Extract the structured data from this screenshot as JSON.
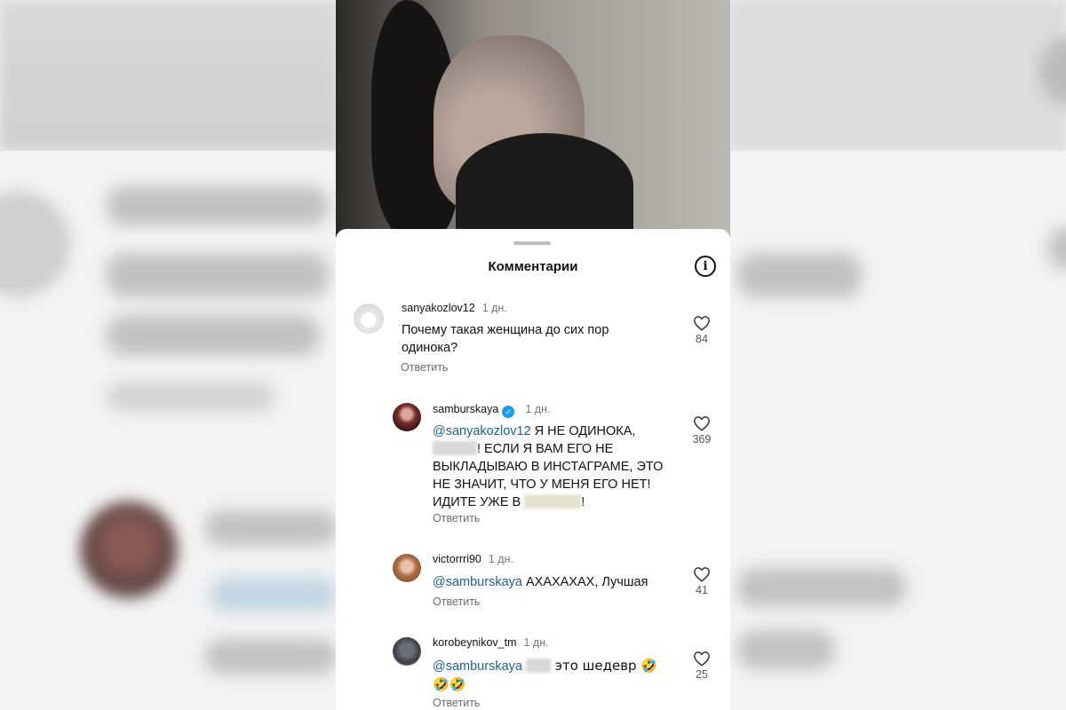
{
  "sheet": {
    "title": "Комментарии"
  },
  "icons": {
    "info": "info-icon",
    "like": "heart-icon",
    "verified": "verified-badge-icon"
  },
  "colors": {
    "mention": "#1e5f8c",
    "verified": "#1d9bf0"
  },
  "comments": [
    {
      "username": "sanyakozlov12",
      "time": "1 дн.",
      "text": "Почему такая женщина до сих пор одинока?",
      "reply_label": "Ответить",
      "likes": "84"
    },
    {
      "username": "samburskaya",
      "verified": true,
      "time": "1 дн.",
      "mention": "@sanyakozlov12",
      "text_a": " Я НЕ ОДИНОКА,",
      "text_b": "! ЕСЛИ Я ВАМ ЕГО НЕ ВЫКЛАДЫВАЮ В ИНСТАГРАМЕ, ЭТО НЕ ЗНАЧИТ, ЧТО У МЕНЯ ЕГО НЕТ! ИДИТЕ УЖЕ В",
      "text_c": "!",
      "reply_label": "Ответить",
      "likes": "369"
    },
    {
      "username": "victorrri90",
      "time": "1 дн.",
      "mention": "@samburskaya",
      "text": " АХАХАХАХ, Лучшая",
      "reply_label": "Ответить",
      "likes": "41"
    },
    {
      "username": "korobeynikov_tm",
      "time": "1 дн.",
      "mention": "@samburskaya",
      "text_a": " ",
      "text_b": " это шедевр 🤣",
      "text_c": "🤣🤣",
      "reply_label": "Ответить",
      "likes": "25"
    }
  ]
}
